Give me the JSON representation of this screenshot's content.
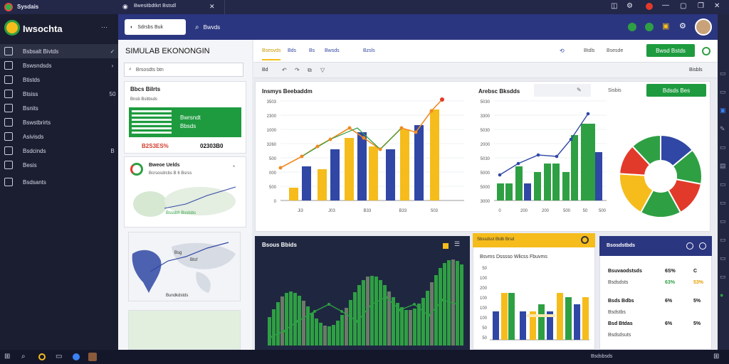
{
  "titlebar": {
    "app_name": "Sysdais",
    "tab_title": "Bwesitbdtkrt Bstsdl"
  },
  "sidebar": {
    "brand": "Iwsochta",
    "items": [
      {
        "label": "Bsbsalt Bivtds",
        "tail": "✓",
        "active": true
      },
      {
        "label": "Bswsndsds",
        "tail": "›"
      },
      {
        "label": "Btistds",
        "tail": ""
      },
      {
        "label": "Btsiss",
        "tail": "50"
      },
      {
        "label": "Bsnits",
        "tail": ""
      },
      {
        "label": "Bswstbrirts",
        "tail": ""
      },
      {
        "label": "Asivisds",
        "tail": ""
      },
      {
        "label": "Bsdcinds",
        "tail": "B"
      },
      {
        "label": "Besis",
        "tail": ""
      },
      {
        "label": "Bsdsants",
        "tail": ""
      }
    ]
  },
  "header": {
    "new_button": "Sdrsbs Buk",
    "search_label": "Bwvds"
  },
  "page": {
    "title": "SIMULAB EKONONGIN",
    "search_placeholder": "Brsosdts btn"
  },
  "toolbar": {
    "tabs": [
      "Bsesvds",
      "Bds",
      "Bs",
      "Bwsds",
      "Bzsls"
    ],
    "right_items": [
      "Btdls",
      "Bsesde"
    ],
    "primary_button": "Bwsd Bstds",
    "sub_left": "Bd",
    "sub_right": "Bisbls"
  },
  "left_panel": {
    "stats_title": "Bbcs Bilrts",
    "stats_sub": "Bnsb Bsitbsds",
    "stats_badge_line1": "Bwrsndt",
    "stats_badge_line2": "Bbsds",
    "stat_a": "B2S3ES%",
    "stat_b": "02303B0",
    "map_title": "Bweoe Uelds",
    "map_sub": "Bcrsosdrcbs B   6 Bsrss",
    "map_link": "Bsssbh Bsslsbs",
    "map2_labels": [
      "Bsg",
      "Btsf",
      "Bundkdstds"
    ]
  },
  "chart1": {
    "title": "Insmys Beebaddm",
    "y_ticks": [
      "3503",
      "2300",
      "1000",
      "3260",
      "500",
      "000",
      "500",
      "0"
    ],
    "x_ticks": [
      "Ji3",
      "J03",
      "B33",
      "B33",
      "503"
    ],
    "colors": {
      "blue": "#3047a5",
      "yellow": "#f5bc1c",
      "green": "#2ea043",
      "orange": "#f08a22",
      "red": "#e23a2a"
    }
  },
  "chart2": {
    "title": "Arebsc Bksdds",
    "tools_label": "Sisbis",
    "green_button": "Bdsds Bes",
    "y_ticks": [
      "5030",
      "3300",
      "5030",
      "2000",
      "5030",
      "5000",
      "5000",
      "3000"
    ],
    "x_ticks": [
      "0",
      "200",
      "200",
      "500",
      "50",
      "500"
    ]
  },
  "chart3": {
    "title": "Bsous Bbids"
  },
  "chart4": {
    "header": "Sbssdsst Btdb Brsd",
    "title": "Bsvms Dsssso Wlicss Fbuvms",
    "y_ticks": [
      "50",
      "100",
      "200",
      "100",
      "100",
      "100",
      "50",
      "50"
    ]
  },
  "right_list": {
    "title": "Bsosdstbds",
    "rows": [
      {
        "name": "Bsuvaodstsds",
        "sub": "Bsdsdsts",
        "pct": "6S%",
        "tail": "C",
        "pct2": "63%",
        "tail2": "53%"
      },
      {
        "name": "Bsds Bdbs",
        "sub": "Bsdstbs",
        "pct": "6%",
        "tail": "5%"
      },
      {
        "name": "Bsd Btdas",
        "sub": "Bsdsdsuts",
        "pct": "6%",
        "tail": "5%"
      }
    ]
  },
  "taskbar": {
    "right_text": "Bsdsbsds"
  }
}
